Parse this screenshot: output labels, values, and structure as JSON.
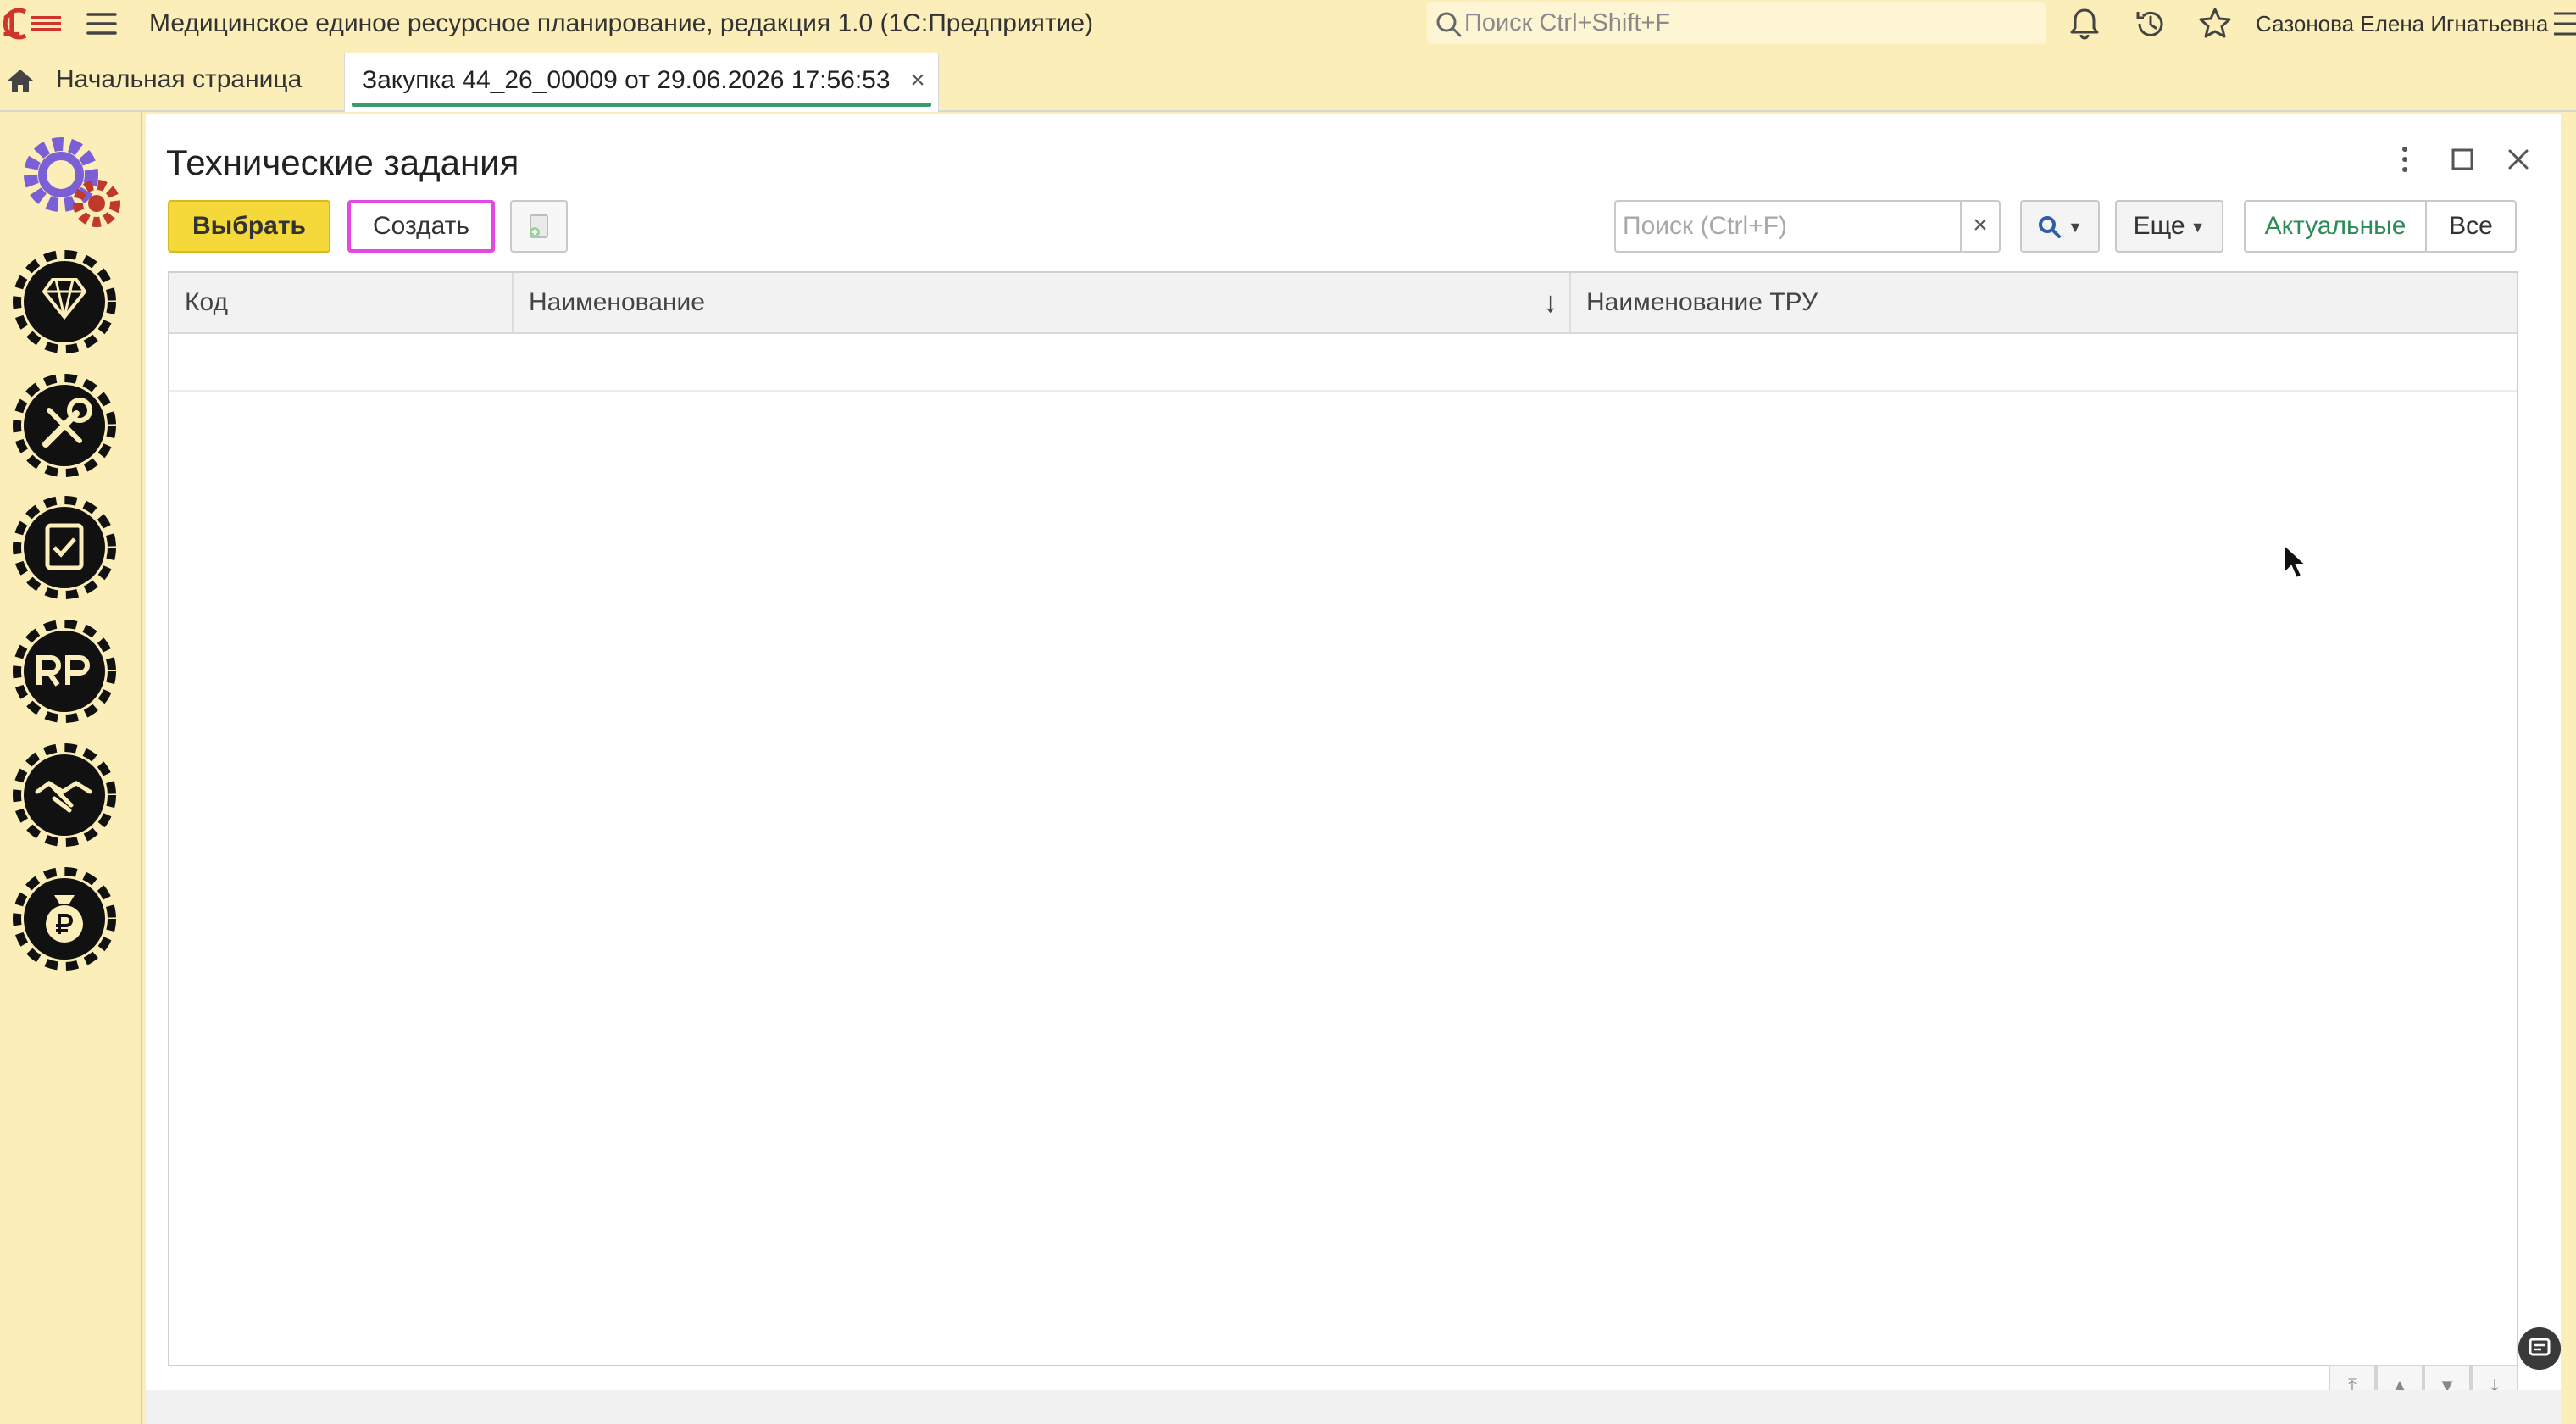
{
  "topbar": {
    "app_title": "Медицинское единое ресурсное планирование, редакция 1.0  (1С:Предприятие)",
    "search_placeholder": "Поиск Ctrl+Shift+F",
    "user_name": "Сазонова Елена Игнатьевна"
  },
  "tabs": {
    "home_label": "Начальная страница",
    "doc_label": "Закупка 44_26_00009 от 29.06.2026 17:56:53",
    "doc_close": "×"
  },
  "sections": [
    {
      "icon": "settings-gear-icon"
    },
    {
      "icon": "diamond-gear-icon"
    },
    {
      "icon": "tools-gear-icon"
    },
    {
      "icon": "document-check-gear-icon"
    },
    {
      "icon": "rp-gear-icon"
    },
    {
      "icon": "handshake-gear-icon"
    },
    {
      "icon": "money-bag-gear-icon"
    }
  ],
  "form": {
    "title": "Технические задания",
    "select_label": "Выбрать",
    "create_label": "Создать",
    "search_placeholder": "Поиск (Ctrl+F)",
    "search_clear": "×",
    "more_label": "Еще",
    "actual_label": "Актуальные",
    "all_label": "Все"
  },
  "table": {
    "columns": [
      "Код",
      "Наименование",
      "Наименование ТРУ"
    ],
    "sort_indicator": "↓",
    "rows": []
  },
  "colors": {
    "panel_bg": "#fbeeb8",
    "select_button": "#f5d93b",
    "create_highlight": "#e447e4",
    "actual_text": "#2e8b57",
    "tab_underline": "#3c9a6c"
  }
}
